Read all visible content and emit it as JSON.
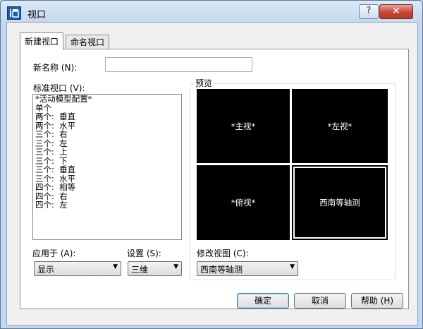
{
  "window": {
    "title": "视口",
    "help_label": "?",
    "close_label": "✕",
    "icon": "app-logo-icon"
  },
  "tabs": [
    {
      "label": "新建视口",
      "active": true
    },
    {
      "label": "命名视口",
      "active": false
    }
  ],
  "new_name": {
    "label": "新名称 (N):",
    "value": ""
  },
  "standard_viewports": {
    "label": "标准视口 (V):",
    "items": [
      "*活动模型配置*",
      "单个",
      "两个:  垂直",
      "两个:  水平",
      "三个:  右",
      "三个:  左",
      "三个:  上",
      "三个:  下",
      "三个:  垂直",
      "三个:  水平",
      "四个:  相等",
      "四个:  右",
      "四个:  左"
    ]
  },
  "preview": {
    "label": "预览",
    "viewports": [
      "*主视*",
      "*左视*",
      "*俯视*",
      "西南等轴测"
    ]
  },
  "apply_to": {
    "label": "应用于 (A):",
    "value": "显示"
  },
  "setup": {
    "label": "设置 (S):",
    "value": "三维"
  },
  "change_view": {
    "label": "修改视图 (C):",
    "value": "西南等轴测"
  },
  "buttons": {
    "ok": "确定",
    "cancel": "取消",
    "help": "帮助 (H)"
  },
  "colors": {
    "accent": "#3c7fb1",
    "close": "#c7473a"
  }
}
